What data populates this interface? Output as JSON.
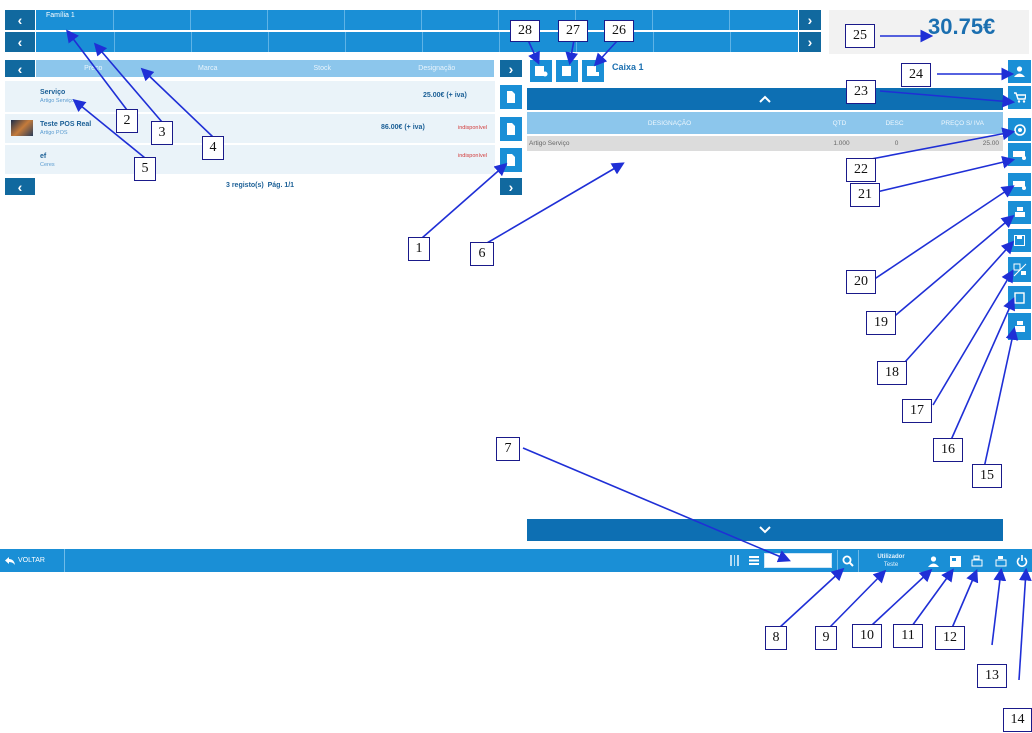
{
  "families": {
    "title": "Família 1"
  },
  "columns": [
    "Preço",
    "Marca",
    "Stock",
    "Designação"
  ],
  "products": [
    {
      "name": "Serviço",
      "sub": "Artigo Serviço",
      "price": "25.00€ (+ iva)",
      "status": ""
    },
    {
      "name": "Teste POS Real",
      "sub": "Artigo POS",
      "price": "86.00€ (+ iva)",
      "status": "indisponível"
    },
    {
      "name": "ef",
      "sub": "Ceres",
      "price": "",
      "status": "indisponível"
    }
  ],
  "pagination": {
    "text": "3 registo(s)  Pág. 1/1"
  },
  "total": {
    "value": "30.75€"
  },
  "cashbox": {
    "title": "Caixa 1"
  },
  "order_table": {
    "headers": [
      "DESIGNAÇÃO",
      "QTD",
      "DESC",
      "PREÇO S/ IVA"
    ],
    "rows": [
      {
        "designation": "Artigo Serviço",
        "qty": "1.000",
        "desc": "0",
        "price": "25.00"
      }
    ]
  },
  "bottombar": {
    "back_label": "VOLTAR",
    "user_label": "Utilizador",
    "user_name": "Teste"
  },
  "icons": {
    "back": "back-arrow-icon",
    "search": "search-icon",
    "user": "user-icon",
    "cart": "cart-icon",
    "power": "power-icon",
    "doc": "document-icon",
    "chevron_up": "chevron-up-icon",
    "chevron_down": "chevron-down-icon"
  },
  "labels": [
    "1",
    "2",
    "3",
    "4",
    "5",
    "6",
    "7",
    "8",
    "9",
    "10",
    "11",
    "12",
    "13",
    "14",
    "15",
    "16",
    "17",
    "18",
    "19",
    "20",
    "21",
    "22",
    "23",
    "24",
    "25",
    "26",
    "27",
    "28"
  ],
  "colors": {
    "primary": "#1a8fd6",
    "dark": "#0d6fb3",
    "nav": "#11699f",
    "header_light": "#8cc6ec",
    "row_bg": "#eaf3f9",
    "total_text": "#1b6fb0",
    "callout_border": "#1a1a8a",
    "arrow": "#1f2fd6",
    "unavailable": "#d23b3b"
  }
}
